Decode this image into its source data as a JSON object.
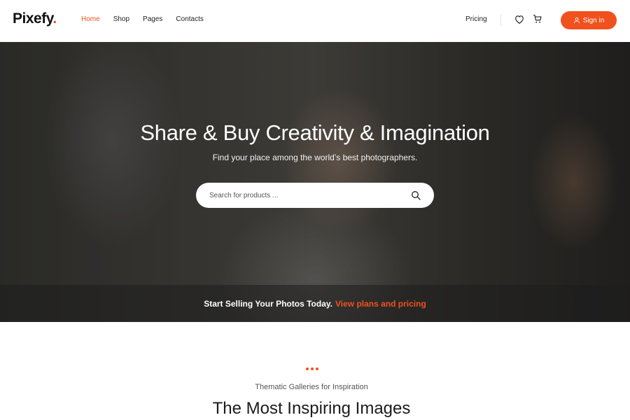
{
  "header": {
    "logo": "Pixefy",
    "logo_dot": ".",
    "nav": [
      {
        "label": "Home",
        "active": true
      },
      {
        "label": "Shop",
        "active": false
      },
      {
        "label": "Pages",
        "active": false
      },
      {
        "label": "Contacts",
        "active": false
      }
    ],
    "pricing": "Pricing",
    "signin": "Sign in",
    "icons": {
      "wishlist": "heart-icon",
      "cart": "cart-icon",
      "user": "user-icon"
    }
  },
  "hero": {
    "title": "Share & Buy Creativity & Imagination",
    "subtitle": "Find your place among the world’s best photographers.",
    "search_placeholder": "Search for products ...",
    "promo_text": "Start Selling Your Photos Today.",
    "promo_link": "View plans and pricing"
  },
  "section": {
    "subtitle": "Thematic Galleries for Inspiration",
    "title": "The Most Inspiring Images"
  },
  "colors": {
    "accent": "#f0511d"
  }
}
